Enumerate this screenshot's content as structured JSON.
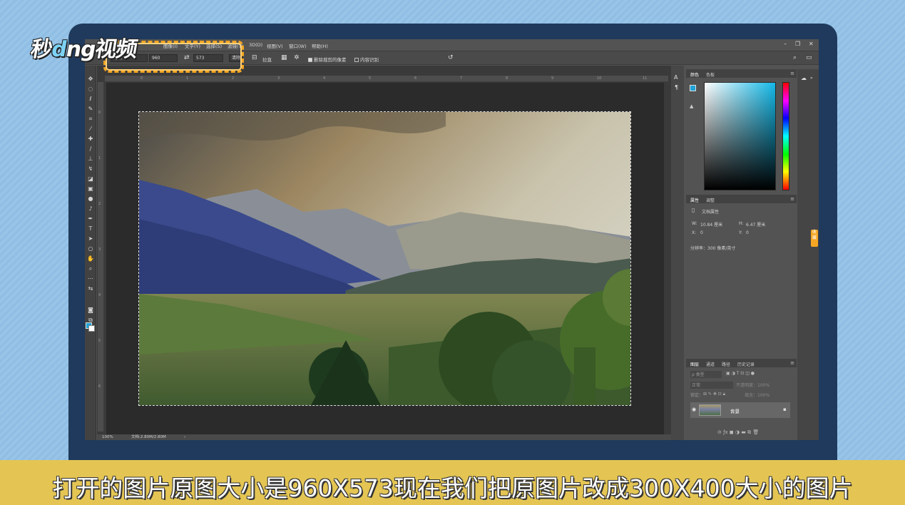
{
  "logo": {
    "part1": "秒",
    "bird": "d",
    "part2": "ng视频"
  },
  "menu": {
    "items": [
      "图像(I)",
      "文字(Y)",
      "选择(S)",
      "滤镜(T)",
      "3D(D)",
      "视图(V)",
      "窗口(W)",
      "帮助(H)"
    ],
    "window_controls": [
      "–",
      "❐",
      "✕"
    ]
  },
  "options": {
    "ratio_label": "比例",
    "width_value": "960",
    "swap_icon": "⇄",
    "height_value": "573",
    "clear_label": "清除",
    "straighten_label": "拉直",
    "delete_pixels_label": "删除裁剪的像素",
    "content_aware_label": "内容识别",
    "reset_icon": "↺"
  },
  "ruler": {
    "h_ticks": [
      "0",
      "1",
      "2",
      "3",
      "4",
      "5",
      "6",
      "7",
      "8",
      "9",
      "10",
      "11"
    ],
    "v_ticks": [
      "0",
      "1",
      "2",
      "3",
      "4",
      "5",
      "6"
    ]
  },
  "status": {
    "zoom": "100%",
    "doc": "文档:2.80M/2.80M"
  },
  "panels": {
    "color_tabs": [
      "颜色",
      "色板"
    ],
    "props_tabs": [
      "属性",
      "调整"
    ],
    "props_title": "文档属性",
    "w_label": "W:",
    "w_value": "10.84 厘米",
    "h_label": "H:",
    "h_value": "6.47 厘米",
    "x_label": "X:",
    "x_value": "0",
    "y_label": "Y:",
    "y_value": "0",
    "resolution": "分辨率：300 像素/英寸",
    "layers_tabs": [
      "图层",
      "通道",
      "路径",
      "历史记录"
    ],
    "layer_kind": "ρ 类型",
    "blend_mode": "正常",
    "opacity": "不透明度：100%",
    "lock": "锁定：",
    "fill": "填充：100%",
    "layer_name": "背景"
  },
  "side_tag": "收藏",
  "subtitle": "打开的图片原图大小是960X573现在我们把原图片改成300X400大小的图片",
  "colors": {
    "fg": "#1fa3d8",
    "bg": "#ffffff",
    "accent": "#f5a623",
    "band": "#e4c553"
  }
}
